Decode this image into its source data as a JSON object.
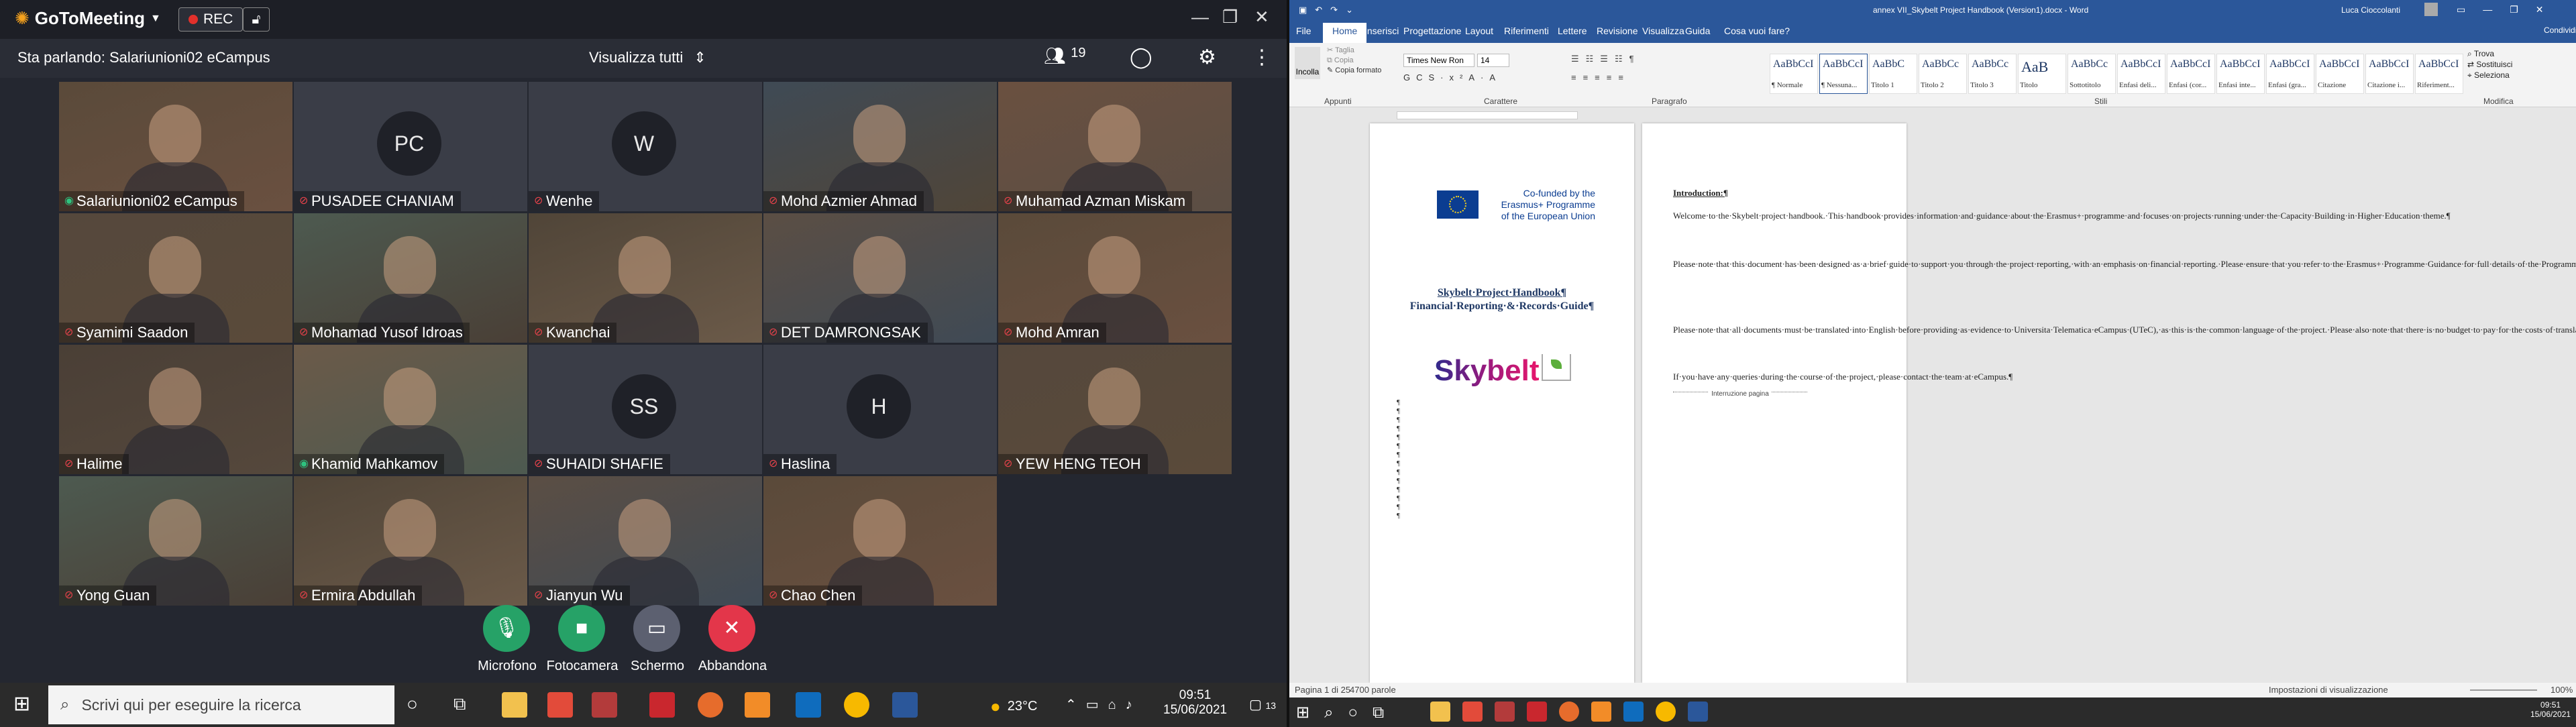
{
  "gotomeeting": {
    "app_name": "GoToMeeting",
    "rec_label": "REC",
    "speaking_label": "Sta parlando: Salariunioni02 eCampus",
    "view_all_label": "Visualizza tutti",
    "participant_count": "19",
    "participants": [
      {
        "name": "Salariunioni02 eCampus",
        "initials": "",
        "muted": false,
        "video": true
      },
      {
        "name": "PUSADEE CHANIAM",
        "initials": "PC",
        "muted": true,
        "video": false
      },
      {
        "name": "Wenhe",
        "initials": "W",
        "muted": true,
        "video": false
      },
      {
        "name": "Mohd Azmier Ahmad",
        "initials": "",
        "muted": true,
        "video": true
      },
      {
        "name": "Muhamad Azman Miskam",
        "initials": "",
        "muted": true,
        "video": true
      },
      {
        "name": "Syamimi Saadon",
        "initials": "",
        "muted": true,
        "video": true
      },
      {
        "name": "Mohamad Yusof Idroas",
        "initials": "",
        "muted": true,
        "video": true
      },
      {
        "name": "Kwanchai",
        "initials": "",
        "muted": true,
        "video": true
      },
      {
        "name": "DET DAMRONGSAK",
        "initials": "",
        "muted": true,
        "video": true
      },
      {
        "name": "Mohd Amran",
        "initials": "",
        "muted": true,
        "video": true
      },
      {
        "name": "Halime",
        "initials": "",
        "muted": true,
        "video": true
      },
      {
        "name": "Khamid Mahkamov",
        "initials": "",
        "muted": false,
        "video": true
      },
      {
        "name": "SUHAIDI SHAFIE",
        "initials": "SS",
        "muted": true,
        "video": false
      },
      {
        "name": "Haslina",
        "initials": "H",
        "muted": true,
        "video": false
      },
      {
        "name": "YEW HENG TEOH",
        "initials": "",
        "muted": true,
        "video": true
      },
      {
        "name": "Yong Guan",
        "initials": "",
        "muted": true,
        "video": true
      },
      {
        "name": "Ermira Abdullah",
        "initials": "",
        "muted": true,
        "video": true
      },
      {
        "name": "Jianyun Wu",
        "initials": "",
        "muted": true,
        "video": true
      },
      {
        "name": "Chao Chen",
        "initials": "",
        "muted": true,
        "video": true
      }
    ],
    "controls": {
      "mic": "Microfono",
      "camera": "Fotocamera",
      "screen": "Schermo",
      "leave": "Abbandona"
    }
  },
  "taskbar_left": {
    "search_placeholder": "Scrivi qui per eseguire la ricerca",
    "temperature": "23°C",
    "time": "09:51",
    "date": "15/06/2021",
    "notifications": "13"
  },
  "word": {
    "title": "annex VII_Skybelt Project Handbook (Version1).docx  -  Word",
    "user": "Luca Cioccolanti",
    "tabs": [
      "File",
      "Home",
      "Inserisci",
      "Progettazione",
      "Layout",
      "Riferimenti",
      "Lettere",
      "Revisione",
      "Visualizza",
      "Guida",
      "Cosa vuoi fare?"
    ],
    "share": "Condividi",
    "clipboard": {
      "paste": "Incolla",
      "cut": "Taglia",
      "copy": "Copia",
      "format": "Copia formato",
      "group": "Appunti"
    },
    "font": {
      "name": "Times New Ron",
      "size": "14",
      "group": "Carattere"
    },
    "paragraph_group": "Paragrafo",
    "styles_group": "Stili",
    "editing_group": "Modifica",
    "editing": [
      "Trova",
      "Sostituisci",
      "Seleziona"
    ],
    "styles": [
      {
        "preview": "AaBbCcI",
        "name": "¶ Normale"
      },
      {
        "preview": "AaBbCcI",
        "name": "¶ Nessuna..."
      },
      {
        "preview": "AaBbC",
        "name": "Titolo 1"
      },
      {
        "preview": "AaBbCc",
        "name": "Titolo 2"
      },
      {
        "preview": "AaBbCc",
        "name": "Titolo 3"
      },
      {
        "preview": "AaB",
        "name": "Titolo"
      },
      {
        "preview": "AaBbCc",
        "name": "Sottotitolo"
      },
      {
        "preview": "AaBbCcI",
        "name": "Enfasi deli..."
      },
      {
        "preview": "AaBbCcI",
        "name": "Enfasi (cor..."
      },
      {
        "preview": "AaBbCcI",
        "name": "Enfasi inte..."
      },
      {
        "preview": "AaBbCcI",
        "name": "Enfasi (gra..."
      },
      {
        "preview": "AaBbCcI",
        "name": "Citazione"
      },
      {
        "preview": "AaBbCcI",
        "name": "Citazione i..."
      },
      {
        "preview": "AaBbCcI",
        "name": "Riferiment..."
      }
    ],
    "page1": {
      "cofunded_line1": "Co-funded by the",
      "cofunded_line2": "Erasmus+ Programme",
      "cofunded_line3": "of the European Union",
      "title_line1": "Skybelt·Project·Handbook¶",
      "title_line2": "Financial·Reporting·&·Records·Guide¶",
      "logo_text": "Skybelt"
    },
    "page2": {
      "heading": "Introduction:¶",
      "p1": "Welcome·to·the·Skybelt·project·handbook.·This·handbook·provides·information·and·guidance·about·the·Erasmus+·programme·and·focuses·on·projects·running·under·the·Capacity·Building·in·Higher·Education·theme.¶",
      "p2": "Please·note·that·this·document·has·been·designed·as·a·brief·guide·to·support·you·through·the·project·reporting,·with·an·emphasis·on·financial·reporting.·Please·ensure·that·you·refer·to·the·Erasmus+·Programme·Guidance·for·full·details·of·the·Programme·requirements.·There·are·links·to·this·documentation·at·the·end·of·this·handbook.·¶",
      "p3": "Please·note·that·all·documents·must·be·translated·into·English·before·providing·as·evidence·to·Universita·Telematica·eCampus·(UTeC),·as·this·is·the·common·language·of·the·project.·Please·also·note·that·there·is·no·budget·to·pay·for·the·costs·of·translation.¶",
      "p4": "If·you·have·any·queries·during·the·course·of·the·project,·please·contact·the·team·at·eCampus.¶",
      "page_break": "Interruzione pagina"
    },
    "status": {
      "page": "Pagina 1 di 25",
      "words": "4700 parole",
      "focus": "Impostazioni di visualizzazione",
      "zoom": "100%"
    },
    "tray_time": "09:51",
    "tray_date": "15/06/2021"
  }
}
